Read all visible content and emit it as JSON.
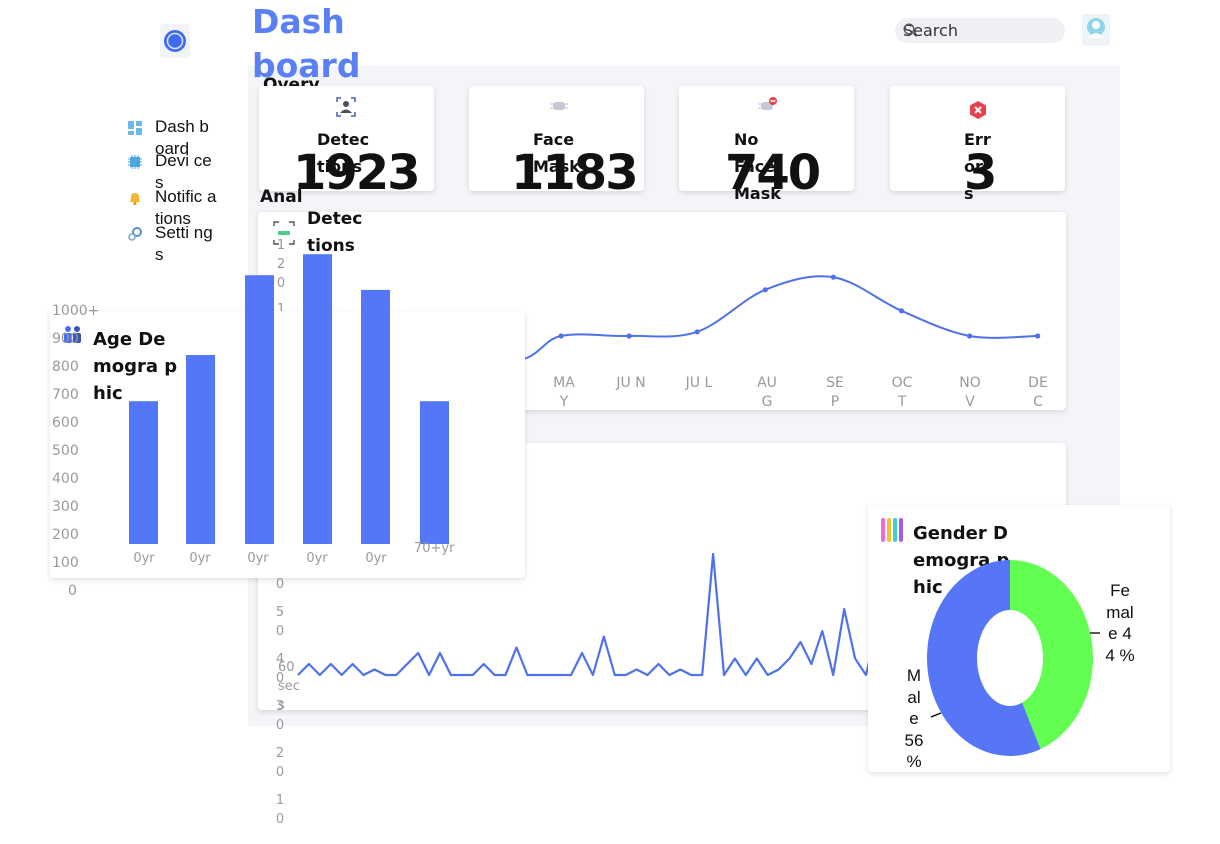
{
  "app": {
    "title": "Dash board",
    "search_placeholder": "Search"
  },
  "sidebar": {
    "items": [
      {
        "label": "Dash board",
        "icon": "dashboard-icon"
      },
      {
        "label": "Devi ces",
        "icon": "chip-icon"
      },
      {
        "label": "Notific ations",
        "icon": "bell-icon"
      },
      {
        "label": "Setti ngs",
        "icon": "gear-icon"
      }
    ]
  },
  "overview": {
    "heading": "Overv iew",
    "cards": [
      {
        "label": "Detec tions",
        "value": "1923",
        "icon": "person-scan-icon"
      },
      {
        "label": "Face Mask",
        "value": "1183",
        "icon": "face-mask-icon"
      },
      {
        "label": "No Face Mask",
        "value": "740",
        "icon": "no-mask-icon"
      },
      {
        "label": "Err or s",
        "value": "3",
        "icon": "error-icon"
      }
    ]
  },
  "analytics": {
    "heading": "Analy tics",
    "detections_title": "Detec tions",
    "yticks": [
      "1 2 0",
      "1"
    ],
    "months": [
      "MA Y",
      "JU N",
      "JU L",
      "AU G",
      "SE P",
      "OC T",
      "NO V",
      "DE C"
    ]
  },
  "timeline": {
    "yticks": [
      "0",
      "5 0",
      "4 0",
      "3 0",
      "2 0",
      "1 0"
    ],
    "unit_label": "60 sec s"
  },
  "age": {
    "title": "Age Demogra phic",
    "ylabels": [
      "1000+",
      "900",
      "800",
      "700",
      "600",
      "500",
      "400",
      "300",
      "200",
      "100",
      "0"
    ],
    "xlabels": [
      "0yr",
      "0yr",
      "0yr",
      "0yr",
      "0yr",
      "70+yr"
    ]
  },
  "gender": {
    "title": "Gender Demogra phic",
    "female_label": "Fe mal e 44 %",
    "male_label": "M al e 56 %"
  },
  "colors": {
    "accent": "#5b7ff5",
    "line": "#4f72e8",
    "bar": "#5477f7",
    "female": "#62ff52",
    "male": "#5676f7",
    "error": "#e8404d"
  },
  "chart_data": [
    {
      "type": "line",
      "title": "Detec tions",
      "categories": [
        "MAY",
        "JUN",
        "JUL",
        "AUG",
        "SEP",
        "OCT",
        "NOV",
        "DEC"
      ],
      "series": [
        {
          "values": [
            57,
            57,
            58,
            68,
            71,
            63,
            57,
            57
          ]
        }
      ]
    },
    {
      "type": "line",
      "series": [
        {
          "values": [
            5,
            7,
            5,
            7,
            5,
            7,
            5,
            6,
            5,
            5,
            7,
            9,
            5,
            9,
            5,
            5,
            5,
            7,
            5,
            5,
            10,
            5,
            5,
            5,
            5,
            5,
            9,
            5,
            12,
            5,
            5,
            6,
            5,
            7,
            5,
            6,
            5,
            5,
            27,
            5,
            8,
            5,
            8,
            5,
            6,
            8,
            11,
            7,
            13,
            5,
            17,
            8,
            5
          ]
        }
      ]
    },
    {
      "type": "bar",
      "title": "Age Demogra phic",
      "categories": [
        "0yr",
        "0yr",
        "0yr",
        "0yr",
        "0yr",
        "70+yr"
      ],
      "values": [
        340,
        450,
        640,
        690,
        605,
        340
      ],
      "ylim": [
        0,
        1000
      ]
    },
    {
      "type": "pie",
      "title": "Gender Demogra phic",
      "labels": [
        "Female",
        "Male"
      ],
      "values": [
        44,
        56
      ]
    }
  ]
}
